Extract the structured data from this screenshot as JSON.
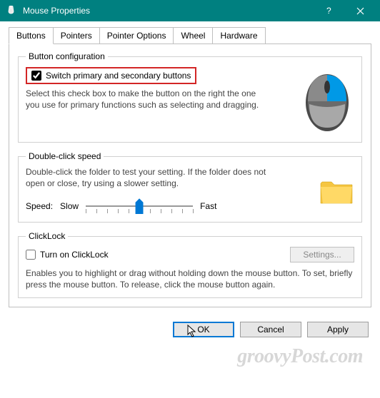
{
  "window": {
    "title": "Mouse Properties"
  },
  "tabs": {
    "buttons": "Buttons",
    "pointers": "Pointers",
    "pointer_options": "Pointer Options",
    "wheel": "Wheel",
    "hardware": "Hardware"
  },
  "button_config": {
    "legend": "Button configuration",
    "switch_label": "Switch primary and secondary buttons",
    "switch_checked": true,
    "description": "Select this check box to make the button on the right the one you use for primary functions such as selecting and dragging."
  },
  "double_click": {
    "legend": "Double-click speed",
    "description": "Double-click the folder to test your setting. If the folder does not open or close, try using a slower setting.",
    "speed_label": "Speed:",
    "slow": "Slow",
    "fast": "Fast"
  },
  "clicklock": {
    "legend": "ClickLock",
    "turn_on_label": "Turn on ClickLock",
    "turn_on_checked": false,
    "settings_label": "Settings...",
    "description": "Enables you to highlight or drag without holding down the mouse button. To set, briefly press the mouse button. To release, click the mouse button again."
  },
  "footer": {
    "ok": "OK",
    "cancel": "Cancel",
    "apply": "Apply"
  },
  "watermark": "groovyPost.com"
}
